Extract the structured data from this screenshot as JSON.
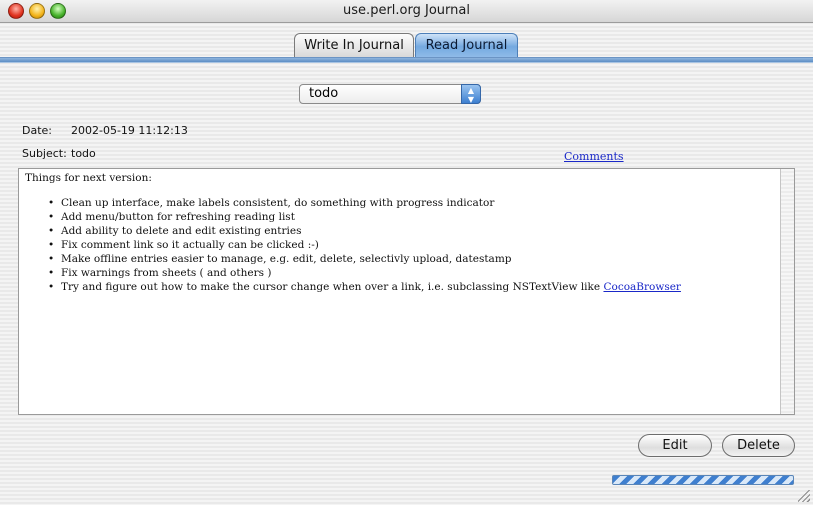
{
  "window": {
    "title": "use.perl.org Journal"
  },
  "tabs": [
    {
      "label": "Write In Journal",
      "selected": false
    },
    {
      "label": "Read Journal",
      "selected": true
    }
  ],
  "entry_popup": {
    "selected": "todo"
  },
  "entry": {
    "date_label": "Date:",
    "date": "2002-05-19 11:12:13",
    "subject_label": "Subject:",
    "subject": "todo",
    "comments_link": "Comments",
    "intro": "Things for next version:",
    "items": [
      "Clean up interface, make labels consistent, do something with progress indicator",
      "Add menu/button for refreshing reading list",
      "Add ability to delete and edit existing entries",
      "Fix comment link so it actually can be clicked :-)",
      "Make offline entries easier to manage, e.g. edit, delete, selectivly upload, datestamp",
      "Fix warnings from sheets ( and others )",
      "Try and figure out how to make the cursor change when over a link, i.e. subclassing NSTextView like "
    ],
    "last_item_link": "CocoaBrowser"
  },
  "buttons": {
    "edit": "Edit",
    "delete": "Delete"
  },
  "icons": {
    "close": "close-icon",
    "minimize": "minimize-icon",
    "zoom": "zoom-icon",
    "popup_arrows": "up-down-arrows-icon",
    "resize": "resize-grip-icon"
  },
  "colors": {
    "accent": "#5d8ec4",
    "link": "#1a28c8",
    "close": "#e0321f",
    "minimize": "#f3b41a",
    "zoom": "#46b22a"
  }
}
